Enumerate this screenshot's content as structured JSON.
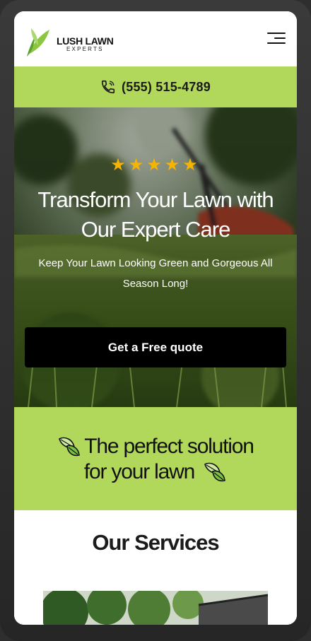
{
  "header": {
    "logo_title": "LUSH LAWN",
    "logo_subtitle": "EXPERTS"
  },
  "phone_bar": {
    "number": "(555) 515-4789"
  },
  "hero": {
    "rating_stars": "★★★★★",
    "title": "Transform Your Lawn with Our Expert Care",
    "subtitle": "Keep Your Lawn Looking Green and Gorgeous All Season Long!",
    "cta_label": "Get a Free quote"
  },
  "tagline": {
    "line1": "The perfect solution",
    "line2": "for your lawn"
  },
  "services": {
    "title": "Our Services"
  },
  "colors": {
    "accent_green": "#b2d85b",
    "cta_black": "#000000",
    "star_gold": "#f6b400"
  },
  "icons": [
    "logo-leaf-icon",
    "menu-icon",
    "phone-icon",
    "leaf-icon"
  ]
}
